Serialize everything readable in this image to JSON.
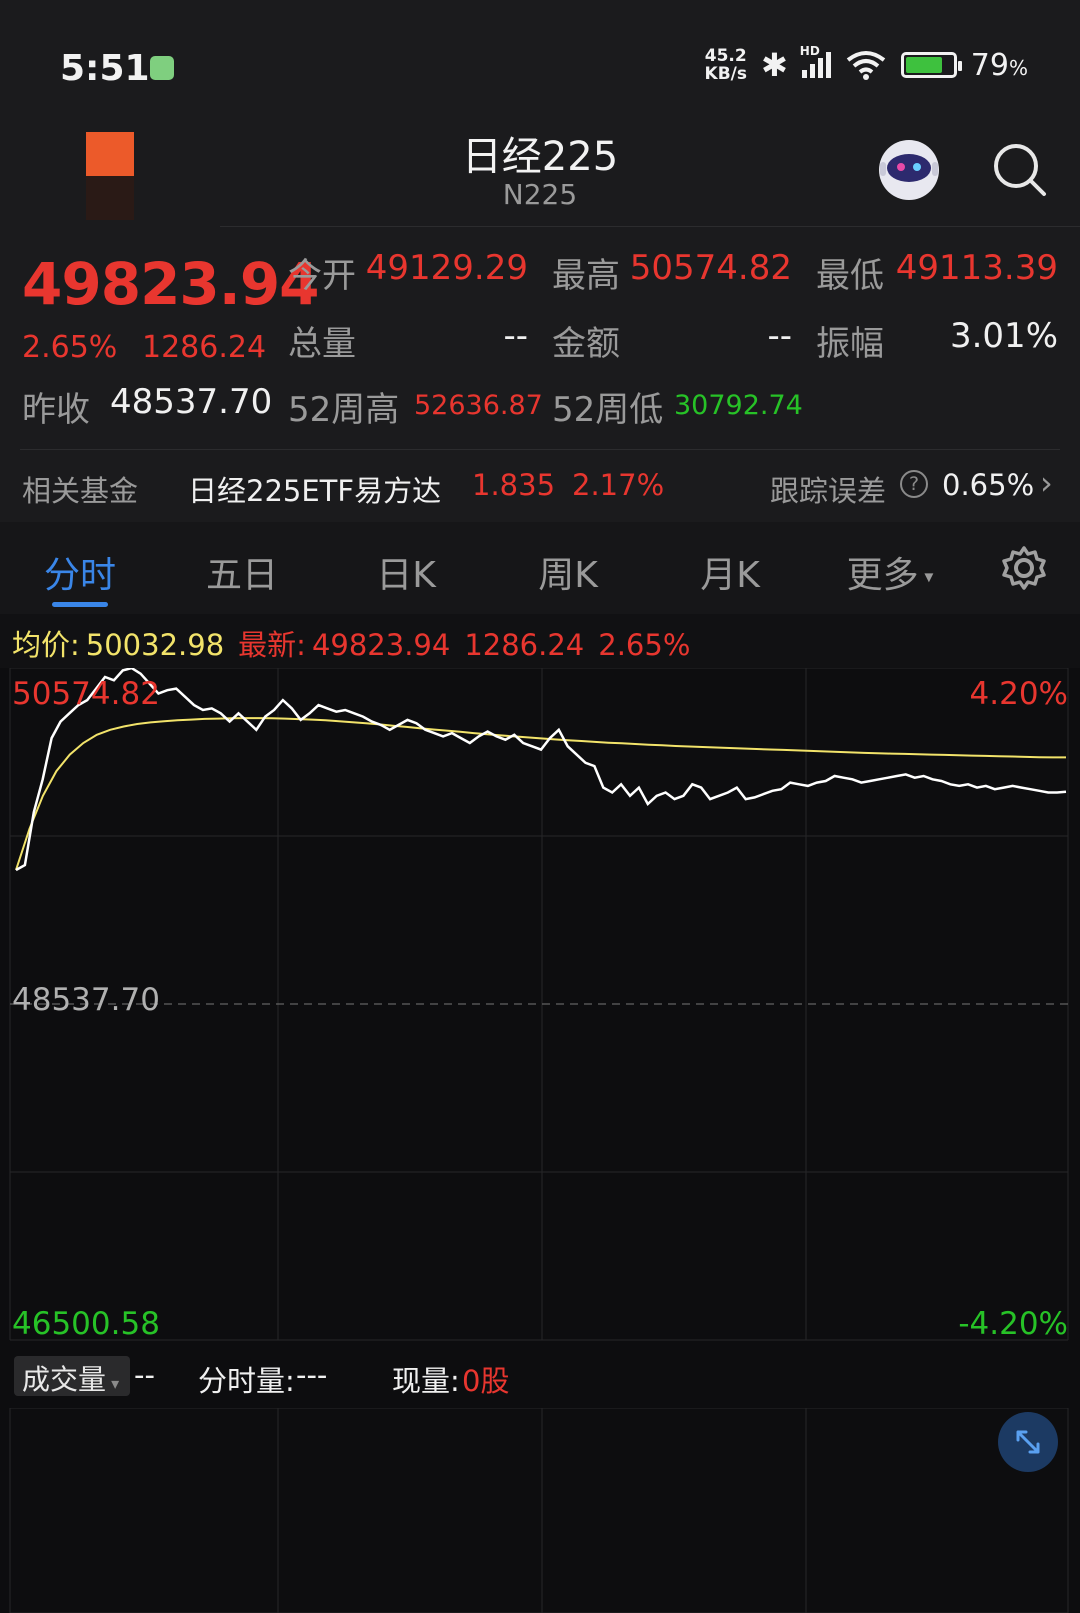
{
  "status_bar": {
    "time": "5:51",
    "net_speed_value": "45.2",
    "net_speed_unit": "KB/s",
    "signal_label": "HD",
    "battery_percent": "79",
    "battery_unit": "%"
  },
  "header": {
    "title": "日经225",
    "subtitle": "N225"
  },
  "quote": {
    "last_price": "49823.94",
    "change_pct": "2.65%",
    "change_amt": "1286.24",
    "prev_close_label": "昨收",
    "prev_close": "48537.70",
    "open_label": "今开",
    "open": "49129.29",
    "high_label": "最高",
    "high": "50574.82",
    "low_label": "最低",
    "low": "49113.39",
    "volume_label": "总量",
    "volume": "--",
    "amount_label": "金额",
    "amount": "--",
    "amplitude_label": "振幅",
    "amplitude": "3.01%",
    "wk52_high_label": "52周高",
    "wk52_high": "52636.87",
    "wk52_low_label": "52周低",
    "wk52_low": "30792.74"
  },
  "related_fund": {
    "label": "相关基金",
    "name": "日经225ETF易方达",
    "price": "1.835",
    "pct": "2.17%",
    "tracking_label": "跟踪误差",
    "tracking_value": "0.65%"
  },
  "tabs": [
    {
      "label": "分时"
    },
    {
      "label": "五日"
    },
    {
      "label": "日K"
    },
    {
      "label": "周K"
    },
    {
      "label": "月K"
    },
    {
      "label": "更多"
    }
  ],
  "info_line": {
    "avg_label": "均价:",
    "avg_value": "50032.98",
    "latest_label": "最新:",
    "latest_value": "49823.94",
    "latest_change": "1286.24",
    "latest_pct": "2.65%"
  },
  "chart_data": {
    "type": "line",
    "y_top": "50574.82",
    "y_mid": "48537.70",
    "y_bottom": "46500.58",
    "pct_top": "4.20%",
    "pct_bottom": "-4.20%",
    "ylim": [
      46500.58,
      50574.82
    ],
    "prev_close": 48537.7,
    "series": [
      {
        "color": "#ffffff",
        "values": [
          49350,
          49380,
          49700,
          49900,
          50150,
          50250,
          50300,
          50350,
          50380,
          50450,
          50520,
          50500,
          50560,
          50574,
          50540,
          50480,
          50420,
          50440,
          50450,
          50400,
          50350,
          50320,
          50330,
          50300,
          50250,
          50300,
          50250,
          50200,
          50280,
          50320,
          50380,
          50330,
          50260,
          50300,
          50350,
          50330,
          50310,
          50320,
          50300,
          50280,
          50250,
          50230,
          50200,
          50230,
          50260,
          50240,
          50200,
          50180,
          50160,
          50180,
          50150,
          50120,
          50160,
          50190,
          50160,
          50140,
          50170,
          50120,
          50100,
          50080,
          50150,
          50200,
          50100,
          50050,
          50000,
          49980,
          49850,
          49820,
          49870,
          49800,
          49850,
          49750,
          49800,
          49820,
          49780,
          49800,
          49870,
          49850,
          49780,
          49800,
          49820,
          49850,
          49780,
          49790,
          49810,
          49830,
          49840,
          49880,
          49870,
          49860,
          49880,
          49890,
          49920,
          49910,
          49900,
          49880,
          49890,
          49900,
          49910,
          49920,
          49930,
          49910,
          49920,
          49900,
          49890,
          49870,
          49860,
          49870,
          49850,
          49860,
          49840,
          49850,
          49860,
          49850,
          49840,
          49830,
          49820,
          49820,
          49823.94
        ]
      },
      {
        "color": "#f2e36a",
        "values": [
          49350,
          49600,
          49800,
          49950,
          50050,
          50120,
          50170,
          50200,
          50220,
          50235,
          50245,
          50252,
          50258,
          50262,
          50266,
          50268,
          50270,
          50271,
          50271,
          50270,
          50268,
          50265,
          50262,
          50258,
          50252,
          50246,
          50240,
          50233,
          50225,
          50218,
          50210,
          50202,
          50195,
          50188,
          50180,
          50173,
          50166,
          50160,
          50154,
          50148,
          50142,
          50137,
          50132,
          50127,
          50122,
          50118,
          50114,
          50110,
          50106,
          50102,
          50099,
          50096,
          50093,
          50090,
          50087,
          50084,
          50081,
          50078,
          50075,
          50072,
          50069,
          50066,
          50063,
          50060,
          50058,
          50056,
          50054,
          50052,
          50050,
          50048,
          50046,
          50044,
          50042,
          50040,
          50038,
          50036,
          50034,
          50033,
          50032.98
        ]
      }
    ]
  },
  "volume_panel": {
    "selector_label": "成交量",
    "volume_value": "--",
    "tick_volume_label": "分时量:",
    "tick_volume_value": "---",
    "current_volume_label": "现量:",
    "current_volume_value": "0股"
  }
}
